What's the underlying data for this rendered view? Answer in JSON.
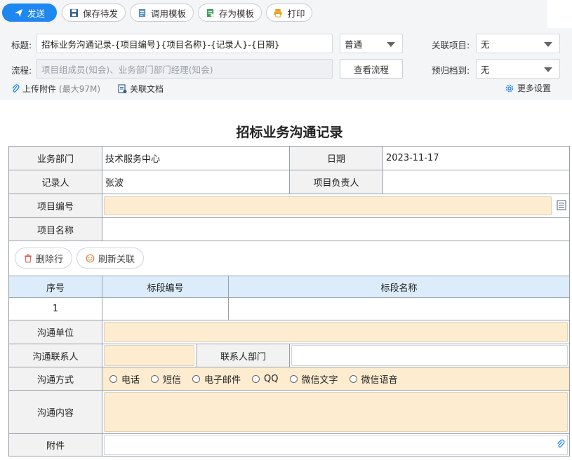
{
  "toolbar": {
    "send": "发送",
    "save_draft": "保存待发",
    "use_template": "调用模板",
    "save_template": "存为模板",
    "print": "打印"
  },
  "header": {
    "title_label": "标题:",
    "title_value": "招标业务沟通记录-{项目编号}{项目名称}-{记录人}-{日期}",
    "priority_value": "普通",
    "related_project_label": "关联项目:",
    "related_project_value": "无",
    "flow_label": "流程:",
    "flow_placeholder": "项目组成员(知会)、业务部门部门经理(知会)",
    "view_flow": "查看流程",
    "archive_label": "预归档到:",
    "archive_value": "无",
    "upload_attachment": "上传附件",
    "upload_limit": "(最大97M)",
    "related_docs": "关联文档",
    "more_settings": "更多设置"
  },
  "form": {
    "title": "招标业务沟通记录",
    "dept_label": "业务部门",
    "dept_value": "技术服务中心",
    "date_label": "日期",
    "date_value": "2023-11-17",
    "recorder_label": "记录人",
    "recorder_value": "张波",
    "leader_label": "项目负责人",
    "leader_value": "",
    "project_no_label": "项目编号",
    "project_name_label": "项目名称",
    "delete_row": "删除行",
    "refresh_link": "刷新关联",
    "table_headers": [
      "序号",
      "标段编号",
      "标段名称"
    ],
    "table_rows": [
      {
        "no": "1",
        "section_no": "",
        "section_name": ""
      }
    ],
    "unit_label": "沟通单位",
    "contact_label": "沟通联系人",
    "contact_dept_label": "联系人部门",
    "method_label": "沟通方式",
    "methods": [
      "电话",
      "短信",
      "电子邮件",
      "QQ",
      "微信文字",
      "微信语音"
    ],
    "content_label": "沟通内容",
    "attachment_label": "附件"
  },
  "colors": {
    "accent": "#1e87f0",
    "input_fill": "#fdeccf",
    "header_fill": "#dcecfb"
  }
}
